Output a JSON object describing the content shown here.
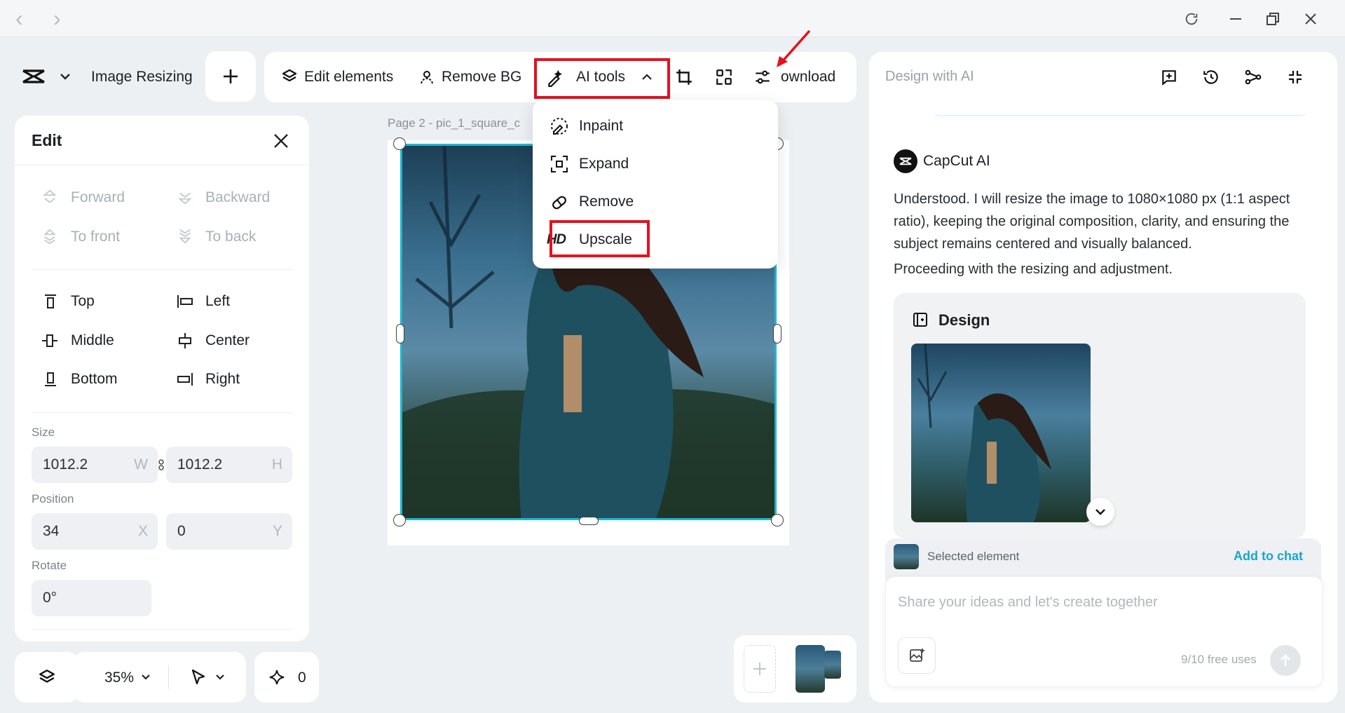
{
  "browser": {
    "back": "‹",
    "forward": "›"
  },
  "project": {
    "title": "Image Resizing"
  },
  "toolbar": {
    "edit_elements": "Edit elements",
    "remove_bg": "Remove BG",
    "ai_tools": "AI tools",
    "download": "ownload"
  },
  "ai_menu": {
    "items": [
      {
        "label": "Inpaint",
        "icon": "inpaint-icon"
      },
      {
        "label": "Expand",
        "icon": "expand-icon"
      },
      {
        "label": "Remove",
        "icon": "eraser-icon"
      },
      {
        "label": "Upscale",
        "icon": "hd-icon",
        "badge": "HD"
      }
    ]
  },
  "edit_panel": {
    "title": "Edit",
    "arrange": [
      "Forward",
      "Backward",
      "To front",
      "To back"
    ],
    "align": [
      "Top",
      "Left",
      "Middle",
      "Center",
      "Bottom",
      "Right"
    ],
    "size_label": "Size",
    "width": "1012.2",
    "width_unit": "W",
    "height": "1012.2",
    "height_unit": "H",
    "position_label": "Position",
    "x": "34",
    "x_unit": "X",
    "y": "0",
    "y_unit": "Y",
    "rotate_label": "Rotate",
    "rotate": "0°"
  },
  "canvas": {
    "page_label": "Page 2 -  pic_1_square_c"
  },
  "bottom_bar": {
    "zoom": "35%",
    "ai_count": "0"
  },
  "ai_panel": {
    "header": "Design with AI",
    "assistant_name": "CapCut AI",
    "message_1": "Understood. I will resize the image to 1080×1080 px (1:1 aspect ratio), keeping the original composition, clarity, and ensuring the subject remains centered and visually balanced.",
    "message_2": "Proceeding with the resizing and adjustment.",
    "design_card_title": "Design",
    "selected_element": "Selected element",
    "add_to_chat": "Add to chat",
    "input_placeholder": "Share your ideas and let's create together",
    "free_uses": "9/10 free uses"
  },
  "colors": {
    "accent": "#1fb8d0",
    "highlight": "#e3121e",
    "link": "#1aa6c9"
  }
}
